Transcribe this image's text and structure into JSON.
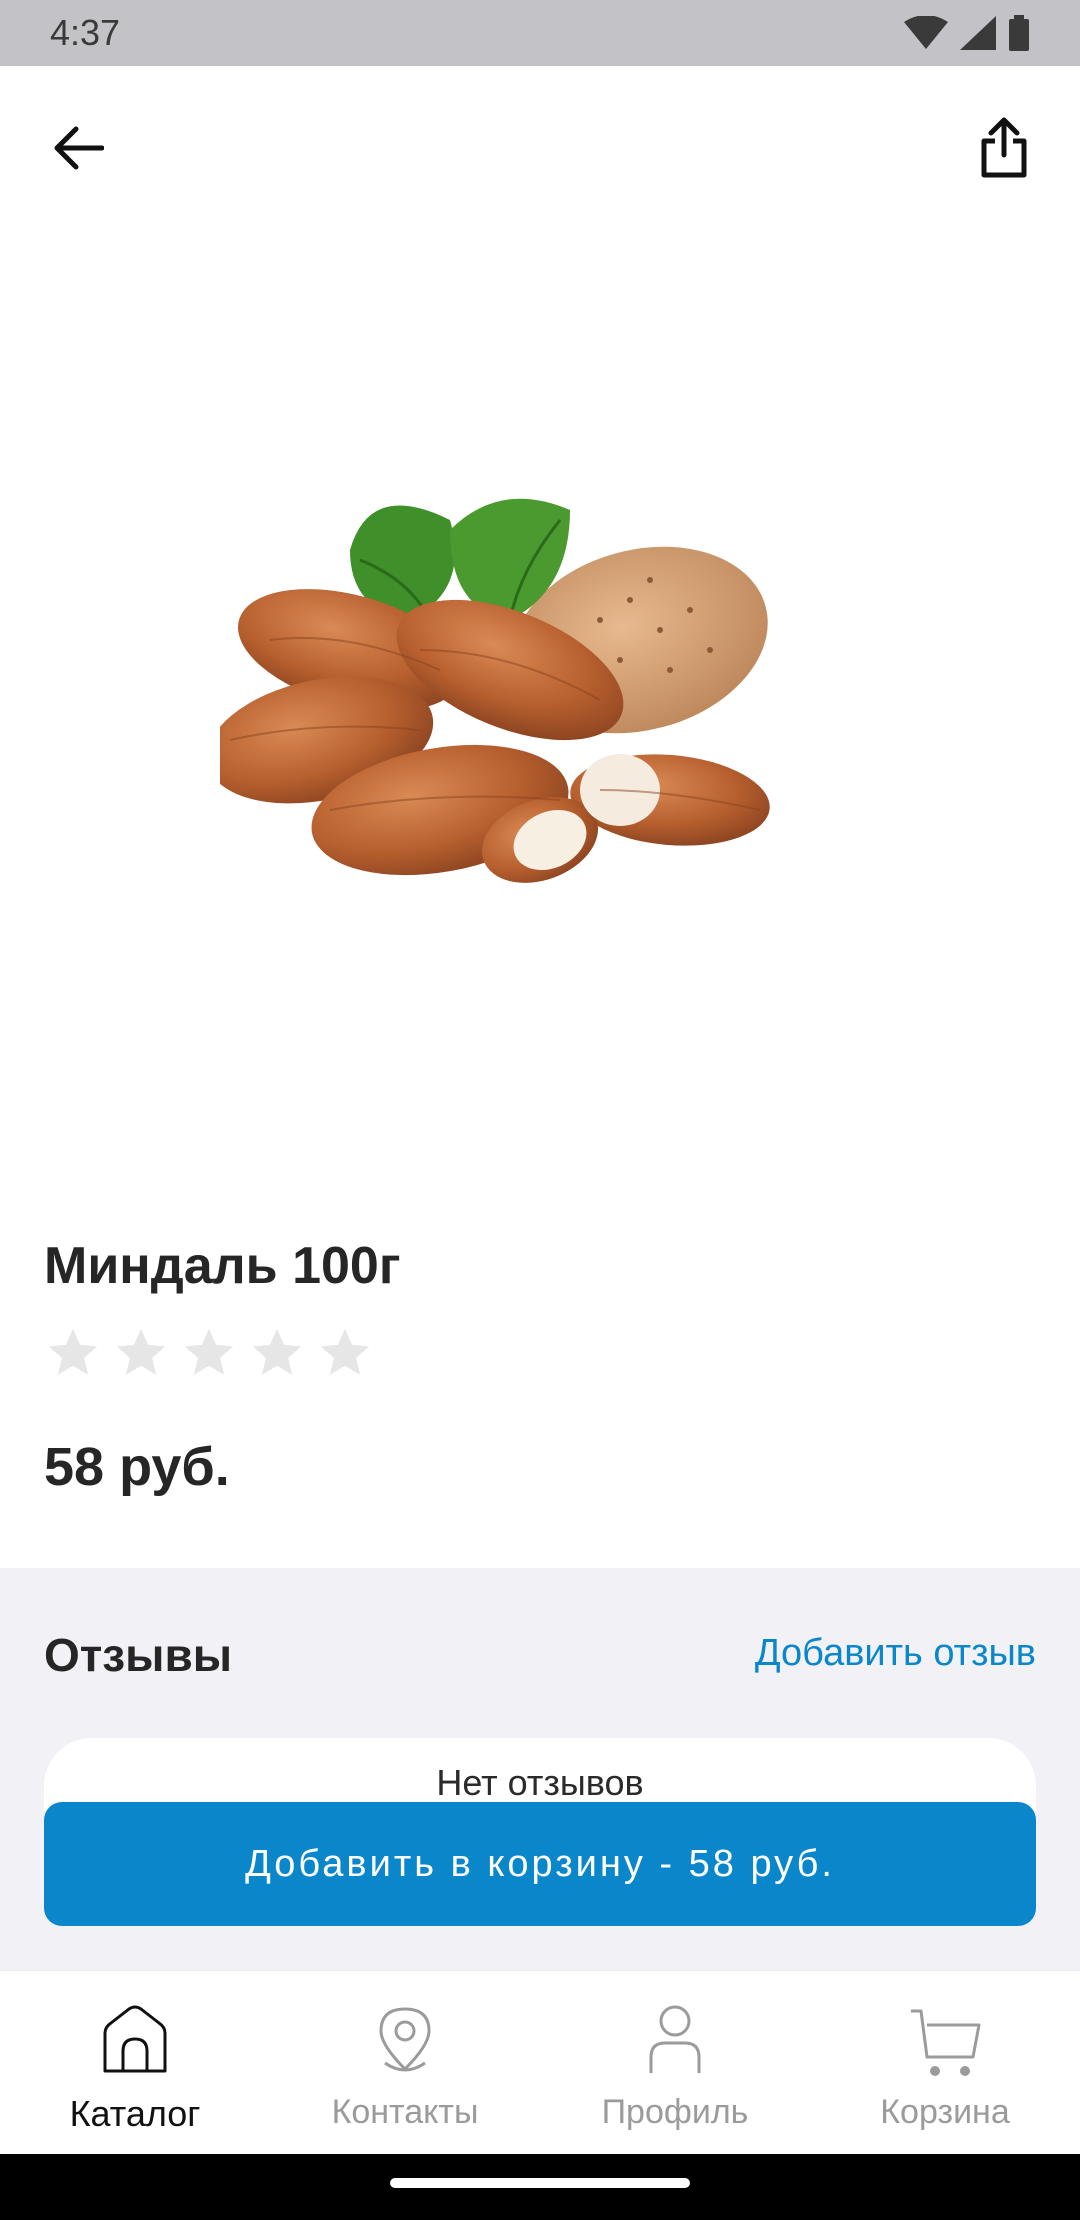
{
  "status_bar": {
    "time": "4:37"
  },
  "product": {
    "title": "Миндаль 100г",
    "rating": 0,
    "rating_max": 5,
    "price": "58 руб."
  },
  "reviews": {
    "title": "Отзывы",
    "add_link": "Добавить отзыв",
    "empty_text": "Нет отзывов"
  },
  "cart_button": {
    "label": "Добавить в корзину - 58 руб."
  },
  "bottom_nav": {
    "items": [
      {
        "label": "Каталог",
        "icon": "home-icon",
        "active": true
      },
      {
        "label": "Контакты",
        "icon": "location-pin-icon",
        "active": false
      },
      {
        "label": "Профиль",
        "icon": "user-icon",
        "active": false
      },
      {
        "label": "Корзина",
        "icon": "cart-icon",
        "active": false
      }
    ]
  },
  "colors": {
    "accent": "#0a87cb",
    "star_empty": "#e6e6e6",
    "section_bg": "#f2f1f6"
  }
}
